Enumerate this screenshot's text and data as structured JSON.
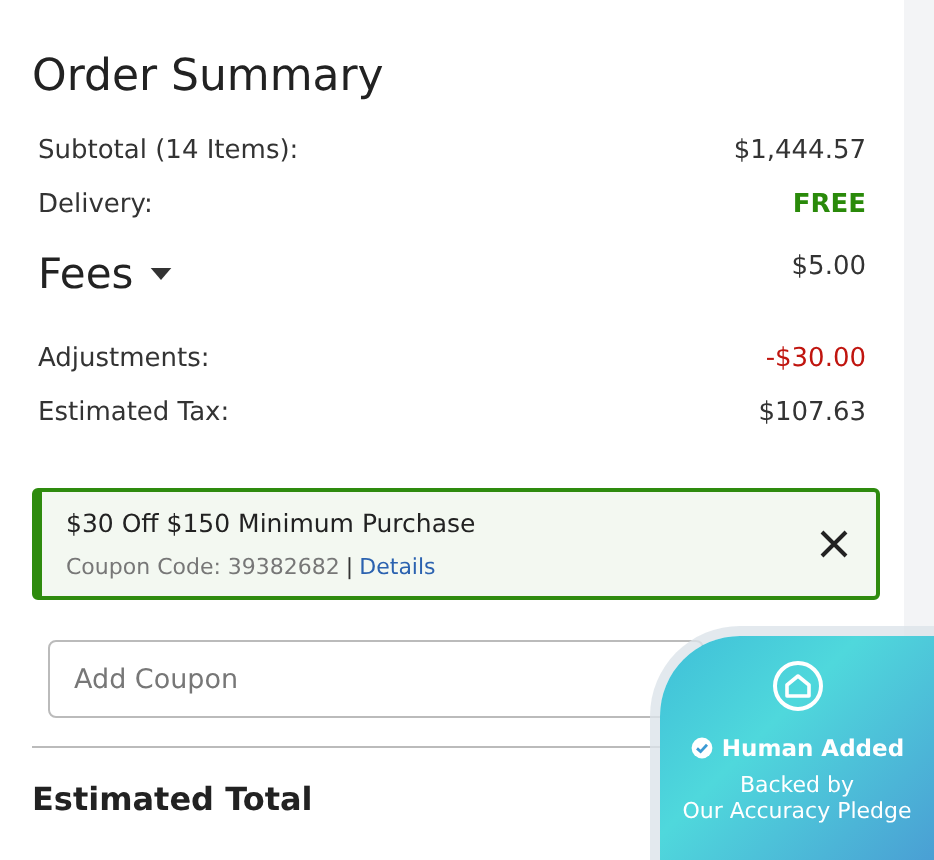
{
  "title": "Order Summary",
  "rows": [
    {
      "kind": "plain",
      "label": "Subtotal (14 Items):",
      "value": "$1,444.57"
    },
    {
      "kind": "free",
      "label": "Delivery:",
      "value": "FREE"
    },
    {
      "kind": "section",
      "label": "Fees",
      "value": "$5.00",
      "expanded": false
    },
    {
      "kind": "discount",
      "label": "Adjustments:",
      "value": "-$30.00"
    },
    {
      "kind": "plain",
      "label": "Estimated Tax:",
      "value": "$107.63"
    }
  ],
  "coupon": {
    "title": "$30 Off $150 Minimum Purchase",
    "code_text": "Coupon Code: 39382682",
    "separator": "|",
    "link": "Details"
  },
  "coupon_field": {
    "placeholder": "Add Coupon"
  },
  "total": {
    "label": "Estimated Total"
  },
  "badge": {
    "title": "Human Added",
    "line_1": "Backed by",
    "line_2": "Our Accuracy Pledge"
  }
}
